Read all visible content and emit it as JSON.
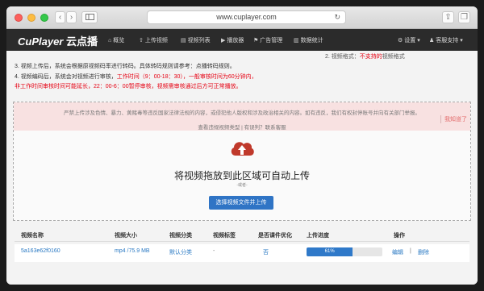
{
  "browser": {
    "url": "www.cuplayer.com"
  },
  "app": {
    "logo": "CuPlayer",
    "logo_cn": "云点播",
    "nav": [
      {
        "label": "概览"
      },
      {
        "label": "上传视频"
      },
      {
        "label": "视频列表"
      },
      {
        "label": "播放器"
      },
      {
        "label": "广告管理"
      },
      {
        "label": "数据统计"
      }
    ],
    "settings": "设置",
    "support": "客服支持"
  },
  "tips": {
    "line3": "3. 视频上传后，系统会根据原视频码率进行转码。具体转码规则请参考：点播转码规则。",
    "line4_prefix": "4. 视频编码后，系统会对视频进行审核，",
    "line4_red": "工作时间（9：00-18：30），一般审核时间为60分钟内，",
    "line5": "非工作时间审核时间可能延长，22：00-6：00暂停审核，视频需审核通过后方可正常播放。",
    "right_top_prefix": "2. 视频格式：",
    "right_top_red": "不支持的",
    "right_top_suffix": "视频格式"
  },
  "upload": {
    "banner_text": "严禁上传涉及色情、暴力、黄赌毒等违反国家法律法规的内容，或侵犯他人版权和涉及政治相关的内容。如有违反，我们有权封停账号并向有关部门举报。",
    "banner_link": "查看违规视频类型 | 有误判？联系客服",
    "know": "我知道了",
    "drop_text": "将视频拖放到此区域可自动上传",
    "or_text": "-或者-",
    "select_btn": "选择视频文件并上传"
  },
  "table": {
    "headers": [
      "视频名称",
      "视频大小",
      "视频分类",
      "视频标签",
      "是否课件优化",
      "上传进度",
      "操作"
    ],
    "rows": [
      {
        "name": "5a163e62f0160",
        "size": "mp4 /75.9 MB",
        "category": "默认分类",
        "tags": "-",
        "optimize": "否",
        "progress": 0.61,
        "progress_label": "61%",
        "edit": "编辑",
        "sep": "|",
        "delete": "删除"
      }
    ]
  },
  "colors": {
    "nav_bg": "#2b2b2b",
    "accent": "#2f74c5",
    "warning_red": "#e60012",
    "banner_bg": "#f8e1e1",
    "cloud_red": "#c0392b"
  },
  "icons": {
    "upload": "cloud-upload-icon",
    "settings": "gear-icon",
    "support": "bell-icon"
  }
}
